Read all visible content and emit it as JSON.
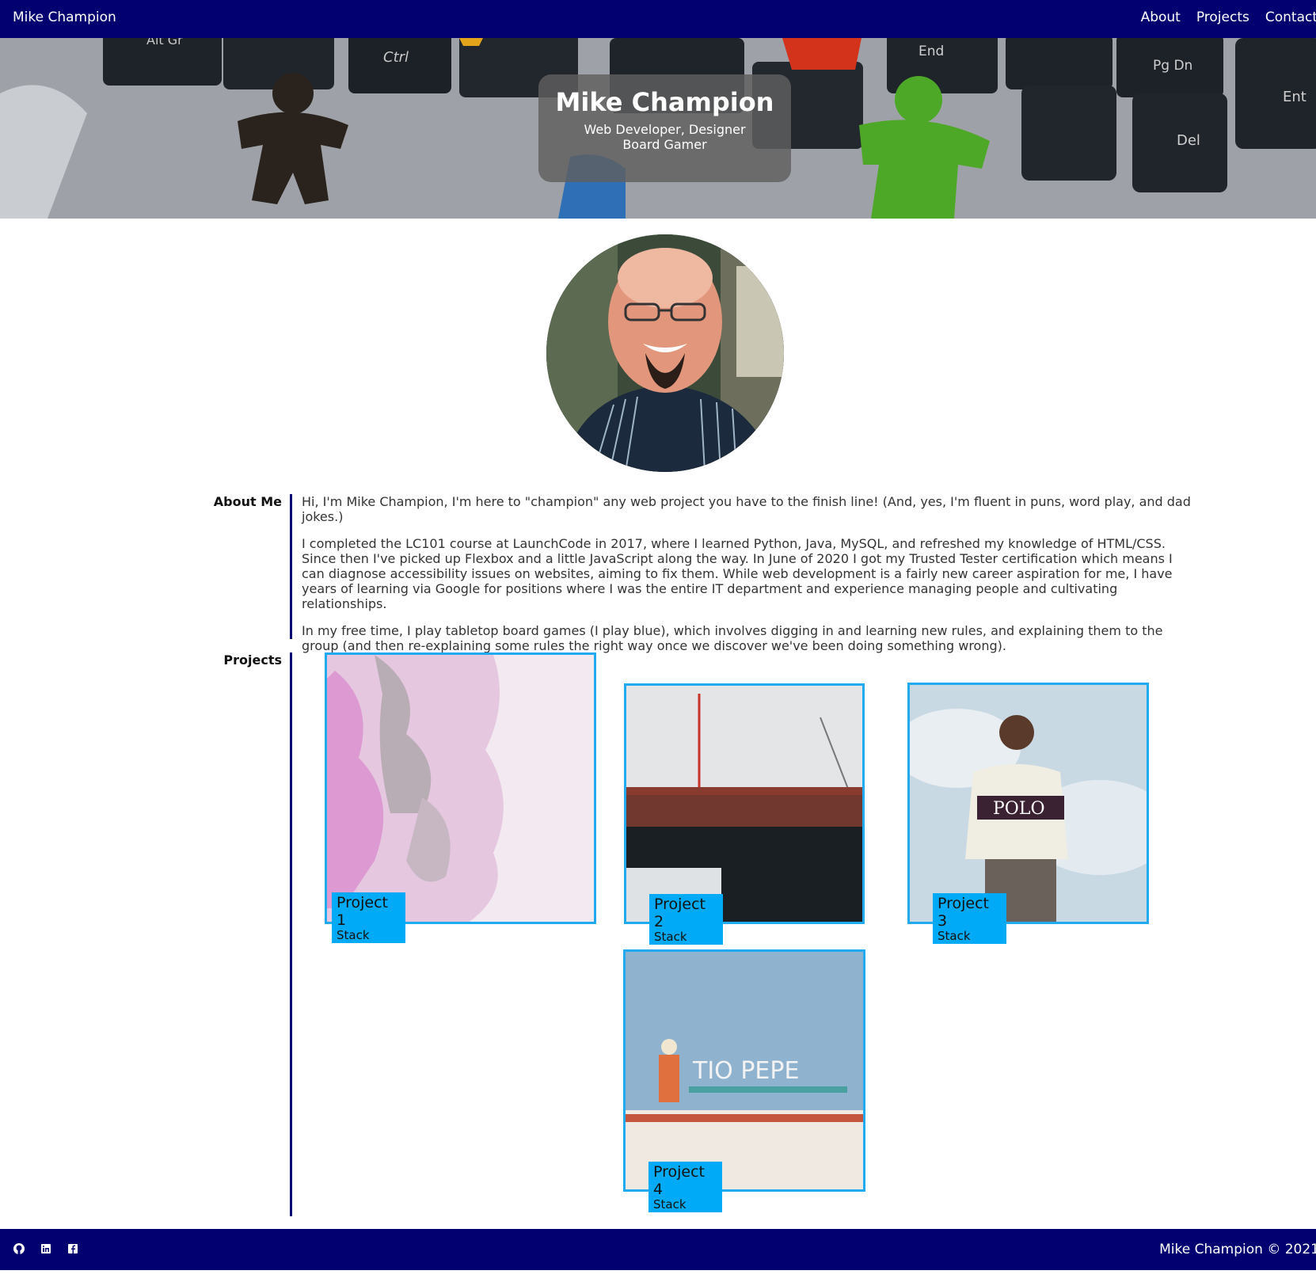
{
  "nav": {
    "brand": "Mike Champion",
    "links": [
      "About",
      "Projects",
      "Contact"
    ]
  },
  "hero": {
    "name": "Mike Champion",
    "subtitle_line1": "Web Developer, Designer",
    "subtitle_line2": "Board Gamer",
    "keys": [
      "Alt Gr",
      "Ctrl",
      "End",
      "Pg Dn",
      "Del",
      "Ent"
    ]
  },
  "about": {
    "label": "About Me",
    "paragraphs": [
      "Hi, I'm Mike Champion, I'm here to \"champion\" any web project you have to the finish line! (And, yes, I'm fluent in puns, word play, and dad jokes.)",
      "I completed the LC101 course at LaunchCode in 2017, where I learned Python, Java, MySQL, and refreshed my knowledge of HTML/CSS. Since then I've picked up Flexbox and a little JavaScript along the way. In June of 2020 I got my Trusted Tester certification which means I can diagnose accessibility issues on websites, aiming to fix them. While web development is a fairly new career aspiration for me, I have years of learning via Google for positions where I was the entire IT department and experience managing people and cultivating relationships.",
      "In my free time, I play tabletop board games (I play blue), which involves digging in and learning new rules, and explaining them to the group (and then re-explaining some rules the right way once we discover we've been doing something wrong)."
    ]
  },
  "projects": {
    "label": "Projects",
    "items": [
      {
        "title": "Project 1",
        "stack": "Stack"
      },
      {
        "title": "Project 2",
        "stack": "Stack"
      },
      {
        "title": "Project 3",
        "stack": "Stack"
      },
      {
        "title": "Project 4",
        "stack": "Stack"
      }
    ],
    "image_text": {
      "polo": "POLO",
      "sign": "TIO PEPE"
    }
  },
  "footer": {
    "icons": [
      "github-icon",
      "linkedin-icon",
      "facebook-icon"
    ],
    "copyright": "Mike Champion © 2021"
  },
  "colors": {
    "nav_bg": "#020070",
    "accent": "#00aaf7",
    "card_border": "#22aaf0"
  }
}
